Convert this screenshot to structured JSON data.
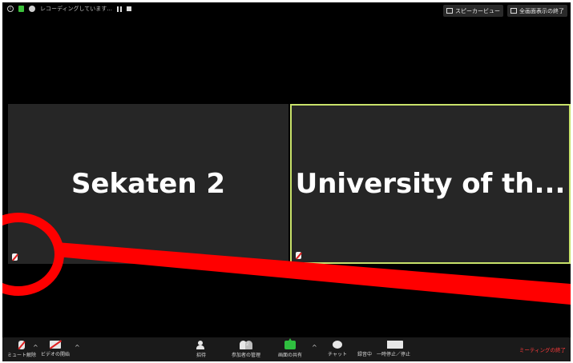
{
  "topbar": {
    "recording_text": "レコーディングしています...",
    "speaker_view_label": "スピーカービュー",
    "fullscreen_exit_label": "全画面表示の終了"
  },
  "participants": [
    {
      "name": "Sekaten 2",
      "muted": true
    },
    {
      "name": "University of th...",
      "muted": true,
      "active_speaker": true
    }
  ],
  "toolbar": {
    "mute_label": "ミュート解除",
    "video_label": "ビデオの開始",
    "invite_label": "招待",
    "participants_label": "参加者の管理",
    "participants_count": "2",
    "share_label": "画面の共有",
    "chat_label": "チャット",
    "record_label": "録音中",
    "pause_stop_label": "一時停止／停止",
    "end_label": "ミーティングの終了"
  },
  "colors": {
    "background": "#000000",
    "tile": "#262626",
    "active_border": "#c8e26a",
    "annotation": "#ff0000",
    "share_green": "#2fbf3f",
    "end_red": "#ff3b3b"
  },
  "annotation": {
    "type": "red circle with pointer line",
    "color": "#ff0000"
  }
}
